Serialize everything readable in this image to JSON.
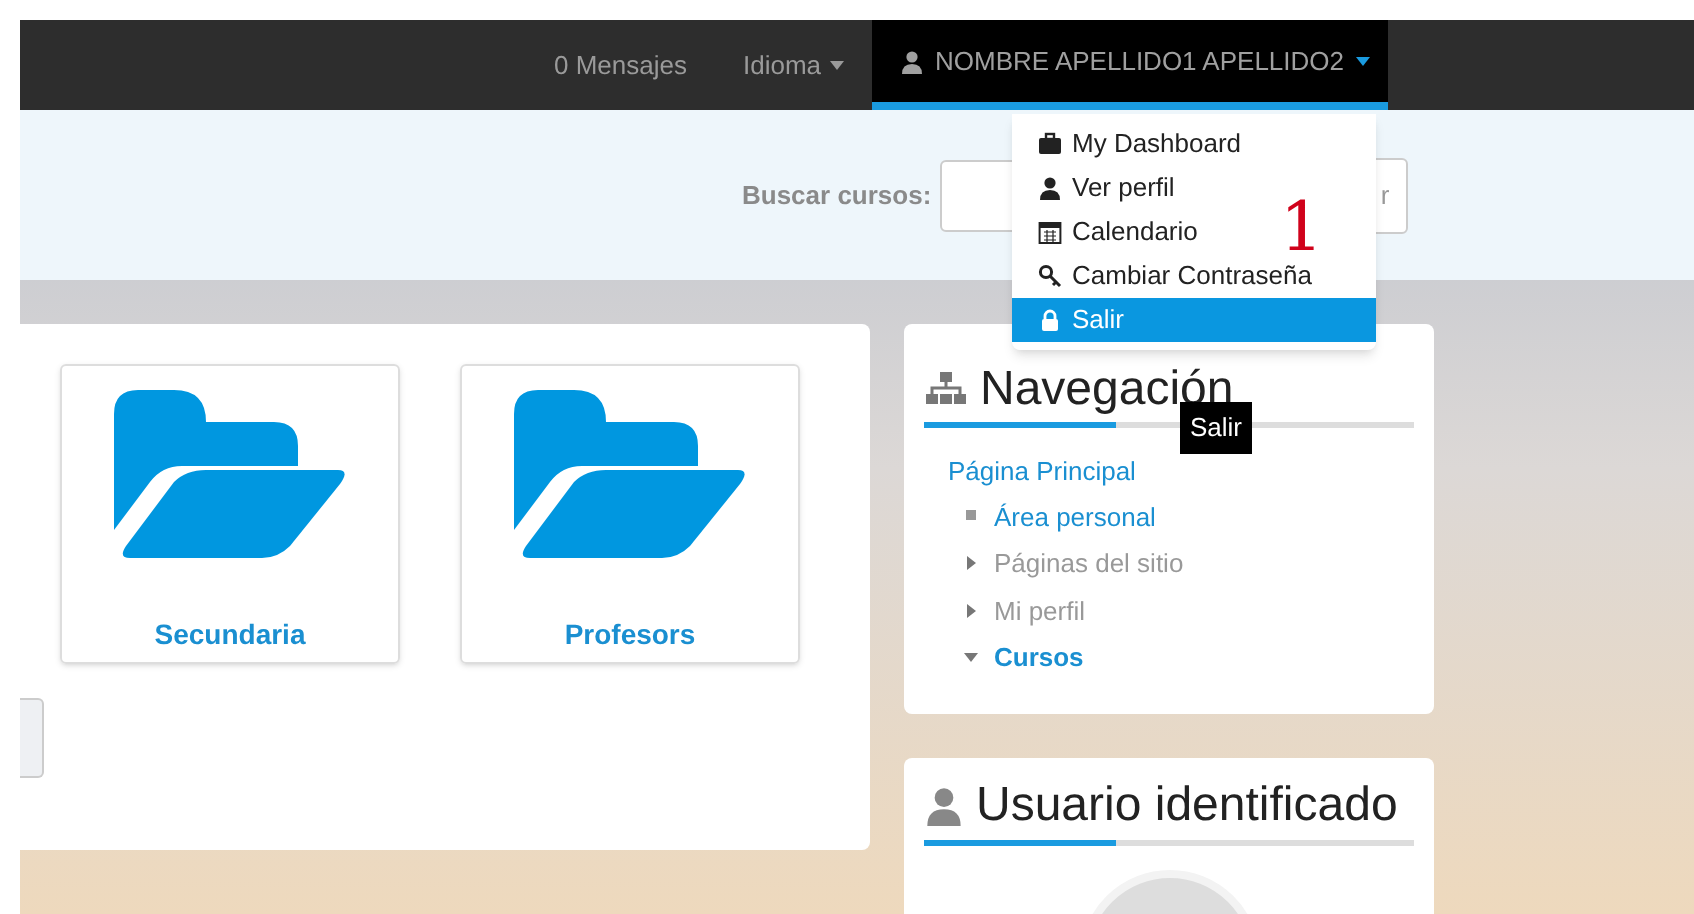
{
  "navbar": {
    "items": [
      {
        "label": "0 Mensajes",
        "kind": "link"
      },
      {
        "label": "Idioma",
        "kind": "dropdown"
      }
    ],
    "user_menu": {
      "label": "NOMBRE APELLIDO1 APELLIDO2",
      "expanded": true
    }
  },
  "search": {
    "label": "Buscar cursos:",
    "button_visible_text": "r"
  },
  "user_dropdown": [
    {
      "label": "My Dashboard",
      "selected": false
    },
    {
      "label": "Ver perfil",
      "selected": false
    },
    {
      "label": "Calendario",
      "selected": false
    },
    {
      "label": "Cambiar Contraseña",
      "selected": false
    },
    {
      "label": "Salir",
      "selected": true
    }
  ],
  "tooltip": "Salir",
  "annotation": "1",
  "categories": [
    {
      "name": "Secundaria"
    },
    {
      "name": "Profesors"
    }
  ],
  "navigation": {
    "title": "Navegación",
    "root": "Página Principal",
    "items": [
      {
        "label": "Área personal",
        "kind": "leaf",
        "link": true
      },
      {
        "label": "Páginas del sitio",
        "kind": "branch",
        "expanded": false,
        "link": false
      },
      {
        "label": "Mi perfil",
        "kind": "branch",
        "expanded": false,
        "link": false
      },
      {
        "label": "Cursos",
        "kind": "branch",
        "expanded": true,
        "link": true
      }
    ]
  },
  "user_block": {
    "title": "Usuario identificado"
  }
}
